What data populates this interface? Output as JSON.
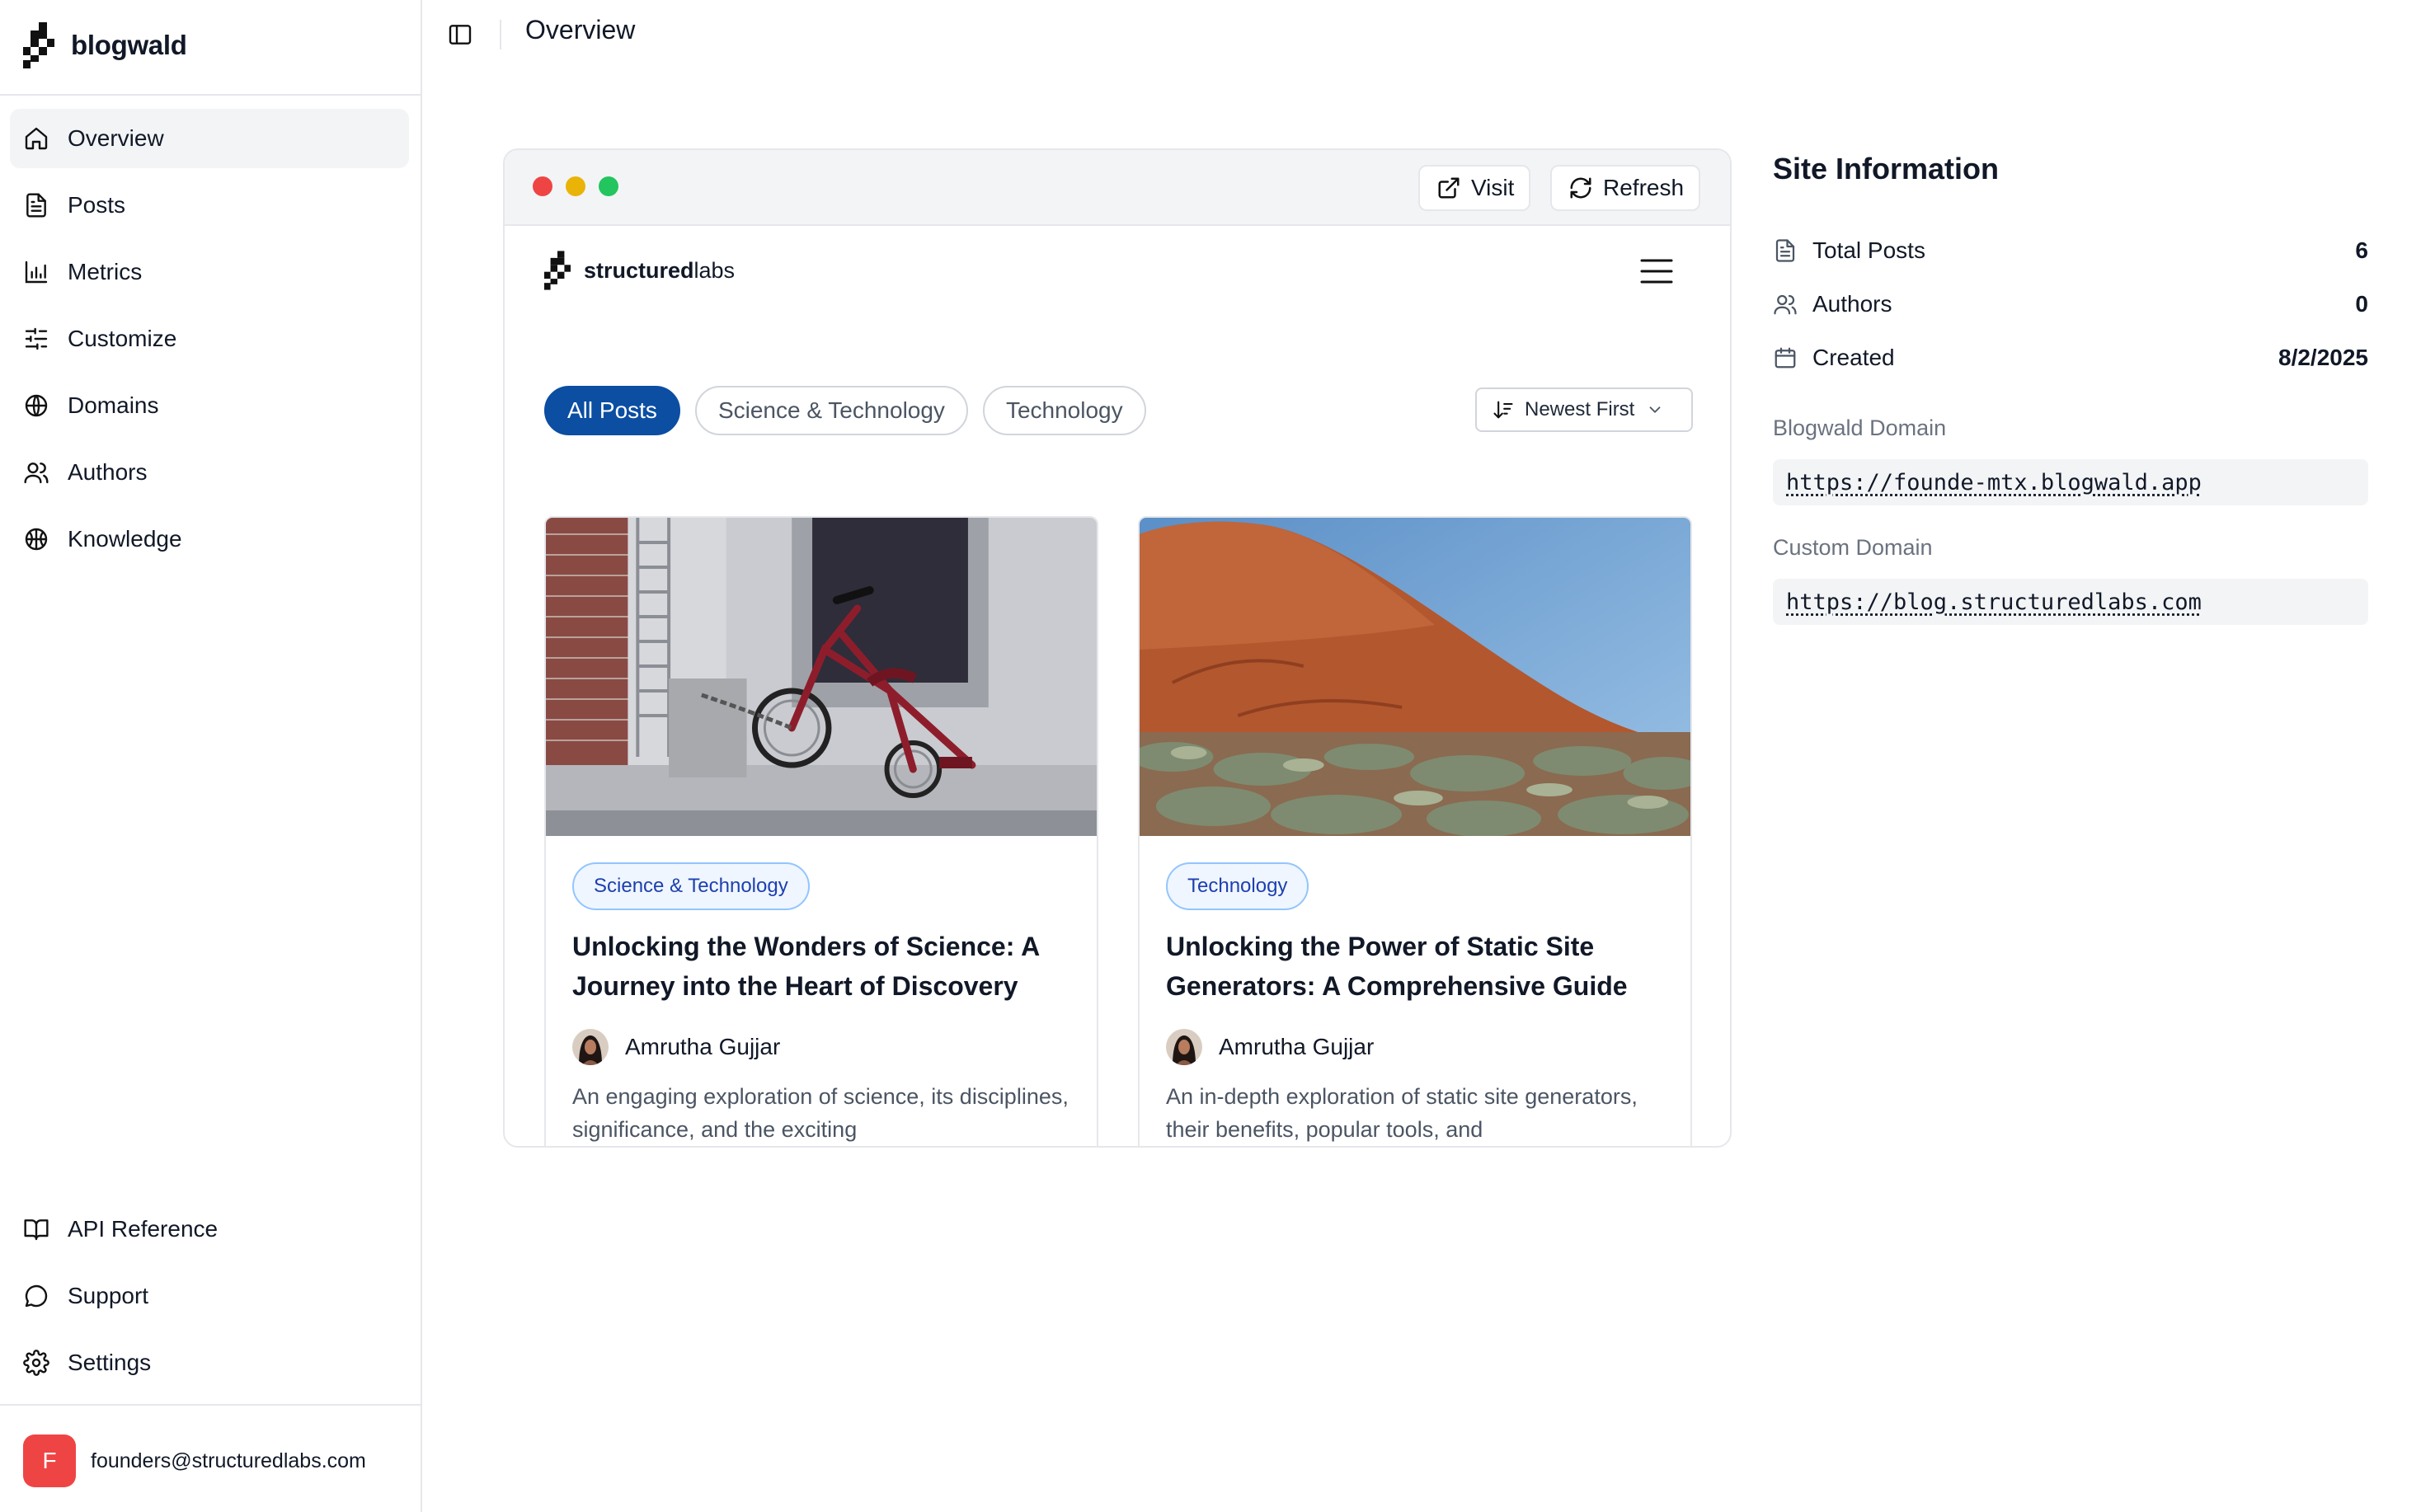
{
  "app": {
    "name": "blogwald"
  },
  "sidebar": {
    "items": [
      {
        "label": "Overview",
        "icon": "home-icon",
        "active": true
      },
      {
        "label": "Posts",
        "icon": "file-text-icon"
      },
      {
        "label": "Metrics",
        "icon": "bar-chart-icon"
      },
      {
        "label": "Customize",
        "icon": "sliders-icon"
      },
      {
        "label": "Domains",
        "icon": "globe-icon"
      },
      {
        "label": "Authors",
        "icon": "users-icon"
      },
      {
        "label": "Knowledge",
        "icon": "basketball-icon"
      }
    ],
    "bottom_items": [
      {
        "label": "API Reference",
        "icon": "book-open-icon"
      },
      {
        "label": "Support",
        "icon": "message-circle-icon"
      },
      {
        "label": "Settings",
        "icon": "gear-icon"
      }
    ],
    "user": {
      "initial": "F",
      "email": "founders@structuredlabs.com",
      "avatar_color": "#ef4444"
    }
  },
  "header": {
    "title": "Overview"
  },
  "preview": {
    "visit_label": "Visit",
    "refresh_label": "Refresh",
    "site": {
      "logo_bold": "structured",
      "logo_light": "labs",
      "filters": [
        "All Posts",
        "Science & Technology",
        "Technology"
      ],
      "sort_label": "Newest First",
      "posts": [
        {
          "tag": "Science & Technology",
          "title": "Unlocking the Wonders of Science: A Journey into the Heart of Discovery",
          "author": "Amrutha Gujjar",
          "excerpt": "An engaging exploration of science, its disciplines, significance, and the exciting"
        },
        {
          "tag": "Technology",
          "title": "Unlocking the Power of Static Site Generators: A Comprehensive Guide",
          "author": "Amrutha Gujjar",
          "excerpt": "An in-depth exploration of static site generators, their benefits, popular tools, and"
        }
      ]
    },
    "accent_color": "#0b4ea2"
  },
  "site_info": {
    "title": "Site Information",
    "stats": [
      {
        "label": "Total Posts",
        "value": "6",
        "icon": "file-text-icon"
      },
      {
        "label": "Authors",
        "value": "0",
        "icon": "users-icon"
      },
      {
        "label": "Created",
        "value": "8/2/2025",
        "icon": "calendar-icon"
      }
    ],
    "blogwald_domain_label": "Blogwald Domain",
    "blogwald_domain": "https://founde-mtx.blogwald.app",
    "custom_domain_label": "Custom Domain",
    "custom_domain": "https://blog.structuredlabs.com"
  }
}
